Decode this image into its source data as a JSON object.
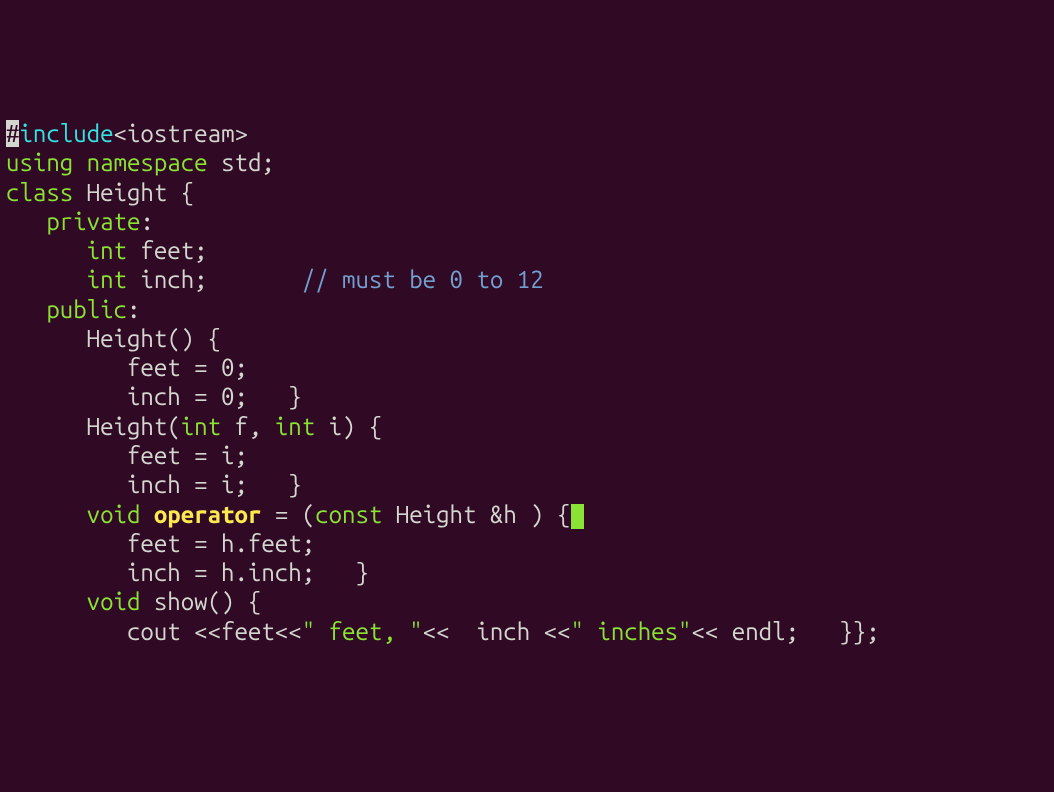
{
  "code": {
    "l1": {
      "hash": "#",
      "include": "include",
      "hdr": "<iostream>"
    },
    "l2": {
      "using": "using",
      "namespace": "namespace",
      "std": "std;"
    },
    "l3": {
      "class": "class",
      "name": "Height {"
    },
    "l4": {
      "private": "private",
      "colon": ":"
    },
    "l5": {
      "int": "int",
      "var": "feet;"
    },
    "l6": {
      "int": "int",
      "var": "inch;",
      "cmt": "// must be 0 to 12"
    },
    "l7": {
      "public": "public",
      "colon": ":"
    },
    "l8": {
      "ctor": "Height() {"
    },
    "l9": {
      "body": "feet = 0;"
    },
    "l10": {
      "body": "inch = 0;   }"
    },
    "l11": {
      "name": "Height(",
      "int1": "int",
      "p1": " f, ",
      "int2": "int",
      "p2": " i) {"
    },
    "l12": {
      "body": "feet = i;"
    },
    "l13": {
      "body": "inch = i;   }"
    },
    "l14": {
      "void": "void",
      "op": "operator",
      "eq": " = (",
      "const": "const",
      "rest": " Height &h ) {"
    },
    "l15": {
      "body": "feet = h.feet;"
    },
    "l16": {
      "body": "inch = h.inch;   }"
    },
    "l17": {
      "void": "void",
      "fn": "show() {"
    },
    "l18": {
      "p1": "cout <<feet<<",
      "s1": "\" feet, \"",
      "p2": "<<  inch <<",
      "s2": "\" inches\"",
      "p3": "<< endl;   }};"
    }
  }
}
